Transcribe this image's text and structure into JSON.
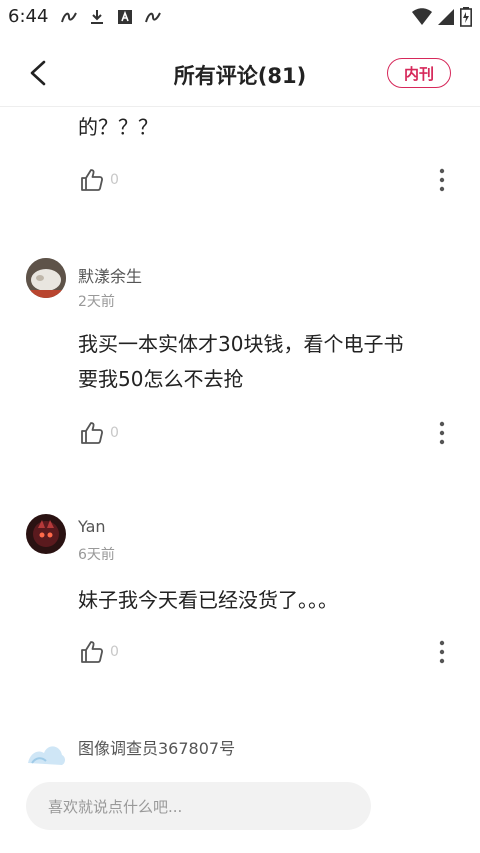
{
  "status_bar": {
    "time": "6:44"
  },
  "header": {
    "title": "所有评论(81)",
    "tag_label": "内刊"
  },
  "comments": [
    {
      "text": "的？？？",
      "likes": "0"
    },
    {
      "user": "默漾余生",
      "time": "2天前",
      "text_lines": [
        "我买一本实体才30块钱，看个电子书",
        "要我50怎么不去抢"
      ],
      "likes": "0"
    },
    {
      "user": "Yan",
      "time": "6天前",
      "text": "妹子我今天看已经没货了。。。",
      "likes": "0"
    },
    {
      "user": "图像调查员367807号"
    }
  ],
  "input": {
    "placeholder": "喜欢就说点什么吧..."
  },
  "colors": {
    "accent": "#d6285a",
    "muted": "#c8c8c8"
  }
}
